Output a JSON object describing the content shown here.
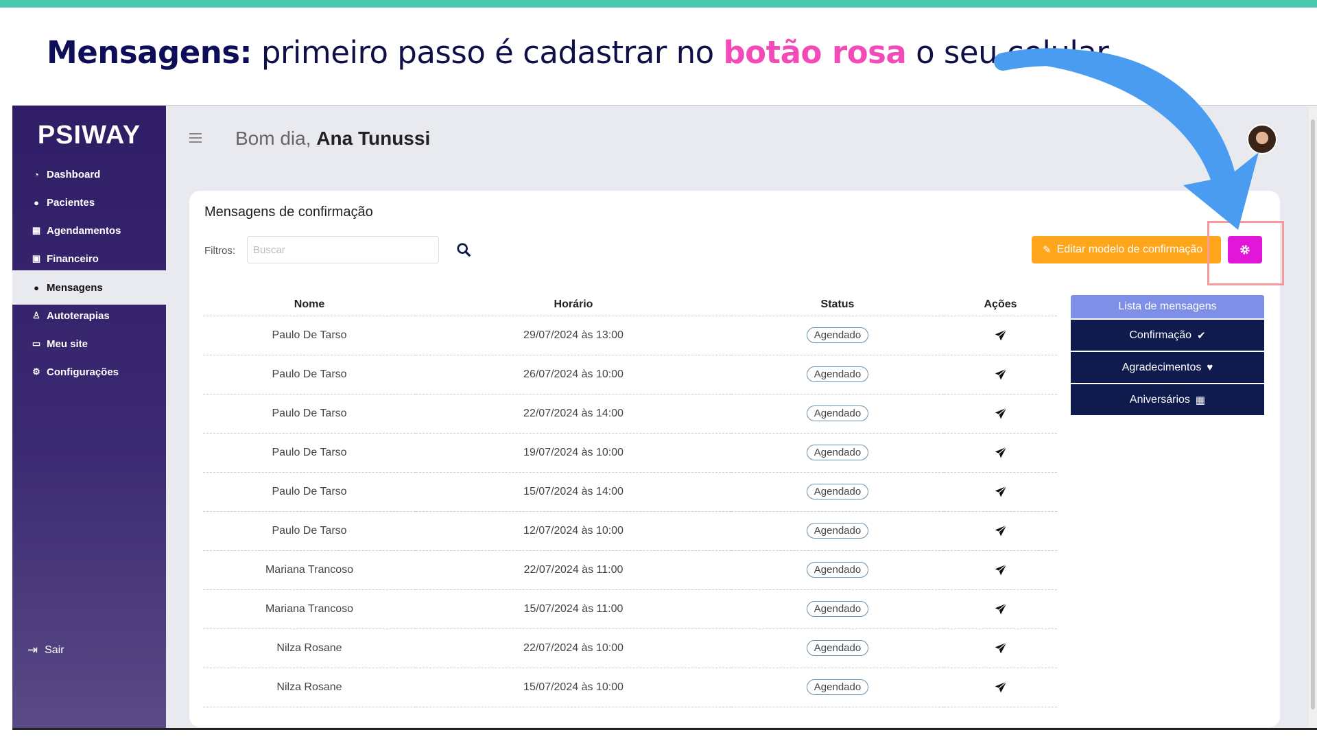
{
  "headline": {
    "prefix_bold": "Mensagens:",
    "middle": " primeiro passo é cadastrar no ",
    "pink": "botão rosa",
    "suffix": " o seu celular"
  },
  "colors": {
    "top_strip": "#48c9ad",
    "pink": "#f24bb8",
    "gear_button": "#e116d8",
    "edit_button": "#ffa51c",
    "arrow": "#4a9cf0",
    "sidebar": "#2f1d66"
  },
  "sidebar": {
    "logo": "PSIWAY",
    "items": [
      {
        "label": "Dashboard",
        "icon": "dashboard-icon"
      },
      {
        "label": "Pacientes",
        "icon": "users-icon"
      },
      {
        "label": "Agendamentos",
        "icon": "calendar-icon"
      },
      {
        "label": "Financeiro",
        "icon": "money-icon"
      },
      {
        "label": "Mensagens",
        "icon": "chat-icon",
        "active": true
      },
      {
        "label": "Autoterapias",
        "icon": "person-icon"
      },
      {
        "label": "Meu site",
        "icon": "monitor-icon"
      },
      {
        "label": "Configurações",
        "icon": "gears-icon"
      }
    ],
    "logout": "Sair"
  },
  "header": {
    "greeting": "Bom dia, ",
    "user": "Ana Tunussi"
  },
  "card": {
    "title": "Mensagens de confirmação",
    "filters_label": "Filtros:",
    "search_placeholder": "Buscar",
    "edit_button": "Editar modelo de confirmação"
  },
  "table": {
    "headers": [
      "Nome",
      "Horário",
      "Status",
      "Ações"
    ],
    "rows": [
      {
        "nome": "Paulo De Tarso",
        "horario": "29/07/2024 às 13:00",
        "status": "Agendado"
      },
      {
        "nome": "Paulo De Tarso",
        "horario": "26/07/2024 às 10:00",
        "status": "Agendado"
      },
      {
        "nome": "Paulo De Tarso",
        "horario": "22/07/2024 às 14:00",
        "status": "Agendado"
      },
      {
        "nome": "Paulo De Tarso",
        "horario": "19/07/2024 às 10:00",
        "status": "Agendado"
      },
      {
        "nome": "Paulo De Tarso",
        "horario": "15/07/2024 às 14:00",
        "status": "Agendado"
      },
      {
        "nome": "Paulo De Tarso",
        "horario": "12/07/2024 às 10:00",
        "status": "Agendado"
      },
      {
        "nome": "Mariana Trancoso",
        "horario": "22/07/2024 às 11:00",
        "status": "Agendado"
      },
      {
        "nome": "Mariana Trancoso",
        "horario": "15/07/2024 às 11:00",
        "status": "Agendado"
      },
      {
        "nome": "Nilza Rosane",
        "horario": "22/07/2024 às 10:00",
        "status": "Agendado"
      },
      {
        "nome": "Nilza Rosane",
        "horario": "15/07/2024 às 10:00",
        "status": "Agendado"
      }
    ]
  },
  "list_panel": {
    "header": "Lista de mensagens",
    "items": [
      {
        "label": "Confirmação",
        "icon": "check-circle-icon"
      },
      {
        "label": "Agradecimentos",
        "icon": "heart-icon"
      },
      {
        "label": "Aniversários",
        "icon": "calendar-icon"
      }
    ]
  }
}
